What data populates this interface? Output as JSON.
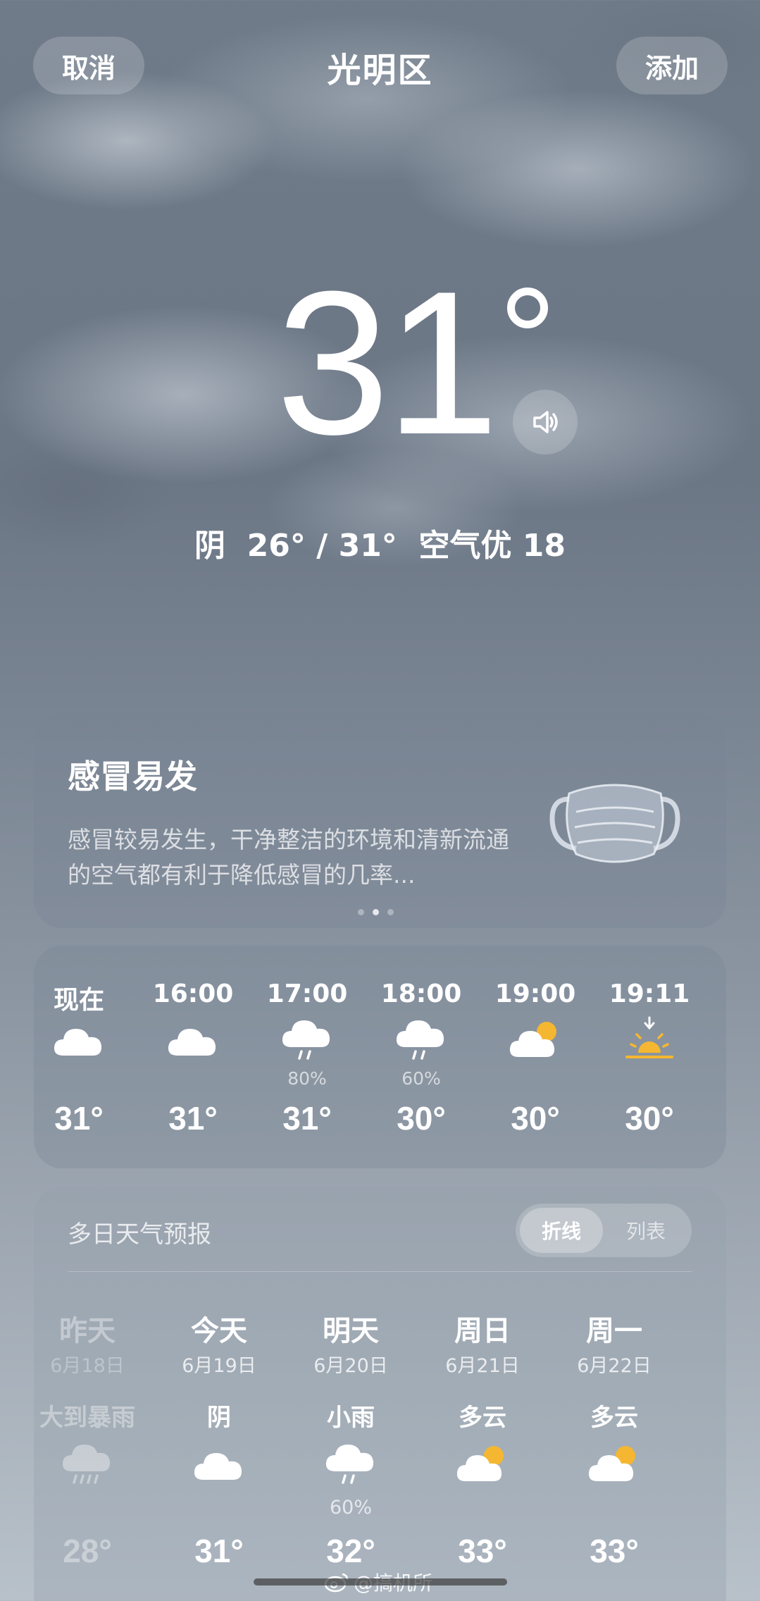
{
  "header": {
    "cancel_label": "取消",
    "city": "光明区",
    "add_label": "添加"
  },
  "current": {
    "temperature": "31",
    "summary": "阴  26° / 31°  空气优 18"
  },
  "tip_card": {
    "title": "感冒易发",
    "text": "感冒较易发生，干净整洁的环境和清新流通的空气都有利于降低感冒的几率..."
  },
  "hourly": [
    {
      "time": "现在",
      "icon": "cloud-icon",
      "prob": "",
      "temp": "31°"
    },
    {
      "time": "16:00",
      "icon": "cloud-icon",
      "prob": "",
      "temp": "31°"
    },
    {
      "time": "17:00",
      "icon": "rain-cloud-icon",
      "prob": "80%",
      "temp": "31°"
    },
    {
      "time": "18:00",
      "icon": "rain-cloud-icon",
      "prob": "60%",
      "temp": "30°"
    },
    {
      "time": "19:00",
      "icon": "partly-cloudy-icon",
      "prob": "",
      "temp": "30°"
    },
    {
      "time": "19:11",
      "icon": "sunset-icon",
      "prob": "",
      "temp": "30°"
    }
  ],
  "daily": {
    "title": "多日天气预报",
    "toggle_line": "折线",
    "toggle_list": "列表",
    "days": [
      {
        "name": "昨天",
        "date": "6月18日",
        "cond": "大到暴雨",
        "icon": "heavy-rain-icon",
        "prob": "",
        "temp": "28°"
      },
      {
        "name": "今天",
        "date": "6月19日",
        "cond": "阴",
        "icon": "cloud-icon",
        "prob": "",
        "temp": "31°"
      },
      {
        "name": "明天",
        "date": "6月20日",
        "cond": "小雨",
        "icon": "rain-cloud-icon",
        "prob": "60%",
        "temp": "32°"
      },
      {
        "name": "周日",
        "date": "6月21日",
        "cond": "多云",
        "icon": "partly-cloudy-icon",
        "prob": "",
        "temp": "33°"
      },
      {
        "name": "周一",
        "date": "6月22日",
        "cond": "多云",
        "icon": "partly-cloudy-icon",
        "prob": "",
        "temp": "33°"
      }
    ]
  },
  "watermark": "@搞机所",
  "colors": {
    "sun": "#f5b731"
  }
}
